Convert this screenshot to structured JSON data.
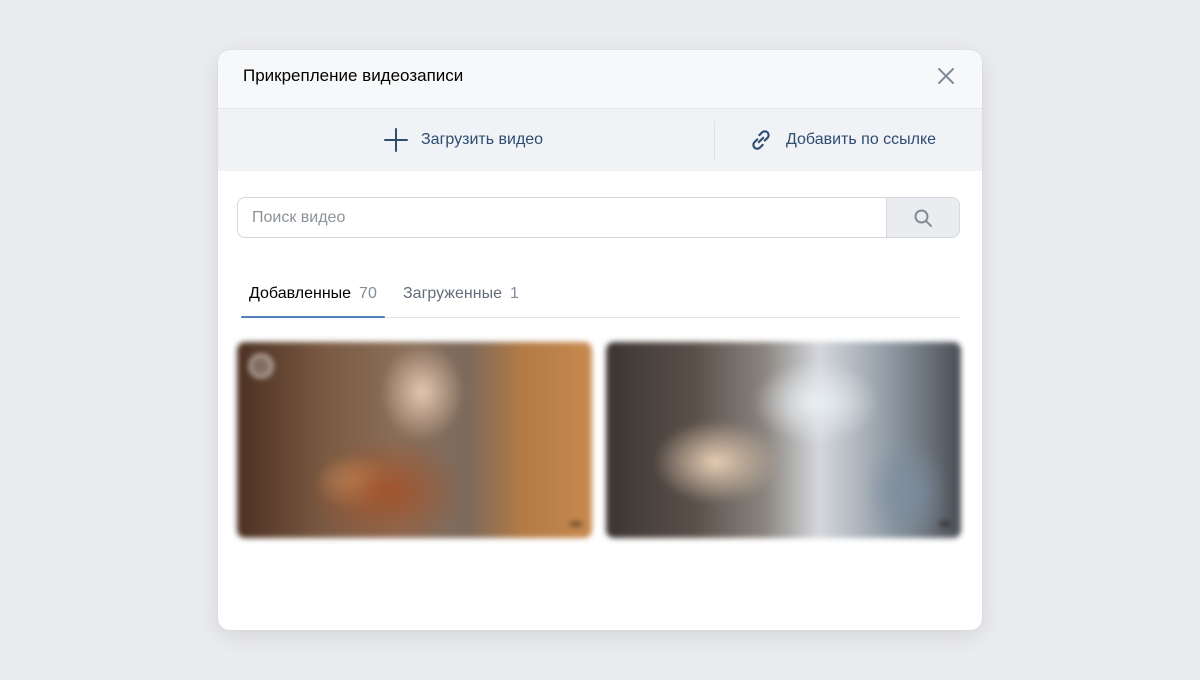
{
  "modal": {
    "title": "Прикрепление видеозаписи"
  },
  "actions": {
    "upload_label": "Загрузить видео",
    "link_label": "Добавить по ссылке"
  },
  "search": {
    "placeholder": "Поиск видео"
  },
  "tabs": [
    {
      "label": "Добавленные",
      "count": "70"
    },
    {
      "label": "Загруженные",
      "count": "1"
    }
  ],
  "colors": {
    "accent": "#5181b8",
    "action_text": "#2d4d73",
    "link_text": "#2a5885"
  }
}
